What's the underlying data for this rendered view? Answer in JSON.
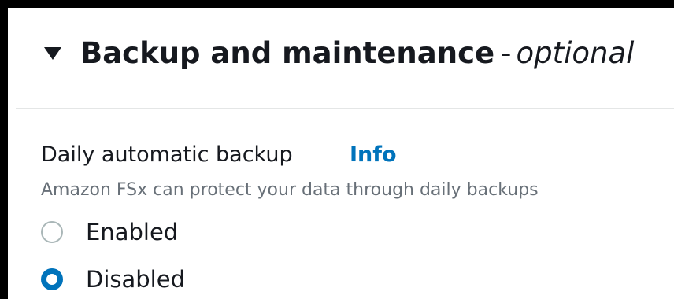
{
  "section": {
    "title": "Backup and maintenance",
    "separator": "-",
    "optional_label": "optional",
    "expanded": true
  },
  "backup_field": {
    "label": "Daily automatic backup",
    "info_link": "Info",
    "description": "Amazon FSx can protect your data through daily backups",
    "options": [
      {
        "label": "Enabled",
        "selected": false
      },
      {
        "label": "Disabled",
        "selected": true
      }
    ]
  },
  "colors": {
    "accent": "#0073bb",
    "text": "#16191f",
    "muted": "#687078",
    "radio_border": "#aab7b8"
  }
}
